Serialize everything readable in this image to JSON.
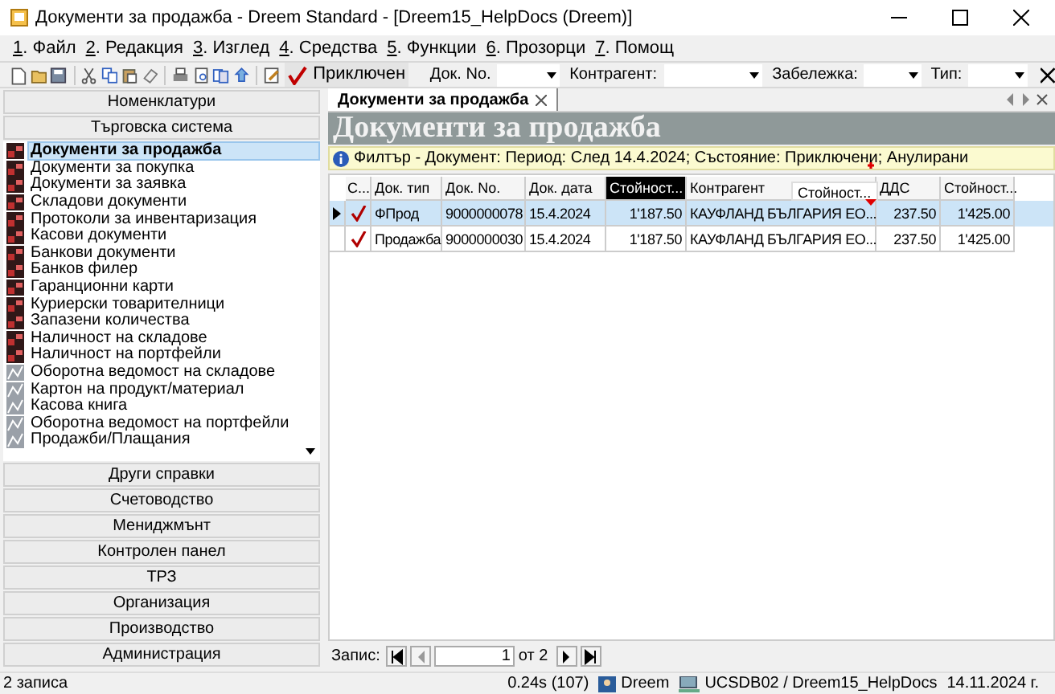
{
  "window": {
    "title": "Документи за продажба - Dreem Standard - [Dreem15_HelpDocs (Dreem)]"
  },
  "menu": [
    {
      "key": "1",
      "label": ". Файл"
    },
    {
      "key": "2",
      "label": ". Редакция"
    },
    {
      "key": "3",
      "label": ". Изглед"
    },
    {
      "key": "4",
      "label": ". Средства"
    },
    {
      "key": "5",
      "label": ". Функции"
    },
    {
      "key": "6",
      "label": ". Прозорци"
    },
    {
      "key": "7",
      "label": ". Помощ"
    }
  ],
  "toolbar": {
    "state_button": "Приключен",
    "filters": [
      {
        "label": "Док. No."
      },
      {
        "label": "Контрагент:"
      },
      {
        "label": "Забележка:"
      },
      {
        "label": "Тип:"
      }
    ]
  },
  "sidebar": {
    "top_sections": [
      {
        "label": "Номенклатури"
      },
      {
        "label": "Търговска система"
      }
    ],
    "items": [
      {
        "label": "Документи за продажба",
        "kind": "doc",
        "selected": true
      },
      {
        "label": "Документи за покупка",
        "kind": "doc",
        "selected": false
      },
      {
        "label": "Документи за заявка",
        "kind": "doc",
        "selected": false
      },
      {
        "label": "Складови документи",
        "kind": "doc",
        "selected": false
      },
      {
        "label": "Протоколи за инвентаризация",
        "kind": "doc",
        "selected": false
      },
      {
        "label": "Касови документи",
        "kind": "doc",
        "selected": false
      },
      {
        "label": "Банкови документи",
        "kind": "doc",
        "selected": false
      },
      {
        "label": "Банков филер",
        "kind": "doc",
        "selected": false
      },
      {
        "label": "Гаранционни карти",
        "kind": "doc",
        "selected": false
      },
      {
        "label": "Куриерски товарителници",
        "kind": "doc",
        "selected": false
      },
      {
        "label": "Запазени количества",
        "kind": "doc",
        "selected": false
      },
      {
        "label": "Наличност на складове",
        "kind": "doc",
        "selected": false
      },
      {
        "label": "Наличност на портфейли",
        "kind": "doc",
        "selected": false
      },
      {
        "label": "Оборотна ведомост на складове",
        "kind": "report",
        "selected": false
      },
      {
        "label": "Картон на продукт/материал",
        "kind": "report",
        "selected": false
      },
      {
        "label": "Касова книга",
        "kind": "report",
        "selected": false
      },
      {
        "label": "Оборотна ведомост на портфейли",
        "kind": "report",
        "selected": false
      },
      {
        "label": "Продажби/Плащания",
        "kind": "report",
        "selected": false
      }
    ],
    "bottom_sections": [
      {
        "label": "Други справки"
      },
      {
        "label": "Счетоводство"
      },
      {
        "label": "Мениджмънт"
      },
      {
        "label": "Контролен панел"
      },
      {
        "label": "ТРЗ"
      },
      {
        "label": "Организация"
      },
      {
        "label": "Производство"
      },
      {
        "label": "Администрация"
      }
    ]
  },
  "document_tab": {
    "label": "Документи за продажба"
  },
  "heading": "Документи за продажба",
  "filter": "Филтър - Документ: Период: След 14.4.2024; Състояние: Приключени; Анулирани",
  "table": {
    "check_column": "С...",
    "columns": [
      {
        "label": "Док. тип",
        "selected": false
      },
      {
        "label": "Док. No.",
        "selected": false
      },
      {
        "label": "Док. дата",
        "selected": false
      },
      {
        "label": "Стойност...",
        "selected": true
      },
      {
        "label": "Контрагент",
        "selected": false
      },
      {
        "label": "ДДС",
        "selected": false
      },
      {
        "label": "Стойност...",
        "selected": false
      }
    ],
    "dragged_column": "Стойност...",
    "rows": [
      {
        "selected": true,
        "checked": true,
        "cells": [
          "ФПрод",
          "9000000078",
          "15.4.2024",
          "1'187.50",
          "КАУФЛАНД БЪЛГАРИЯ ЕО...",
          "237.50",
          "1'425.00"
        ]
      },
      {
        "selected": false,
        "checked": true,
        "cells": [
          "Продажба",
          "9000000030",
          "15.4.2024",
          "1'187.50",
          "КАУФЛАНД БЪЛГАРИЯ ЕО...",
          "237.50",
          "1'425.00"
        ]
      }
    ]
  },
  "pager": {
    "label": "Запис:",
    "current": "1",
    "of": "от 2"
  },
  "status_bar": {
    "records": "2 записа",
    "timing": "0.24s (107)",
    "user": "Dreem",
    "database": "UCSDB02 / Dreem15_HelpDocs",
    "date": "14.11.2024 г."
  }
}
